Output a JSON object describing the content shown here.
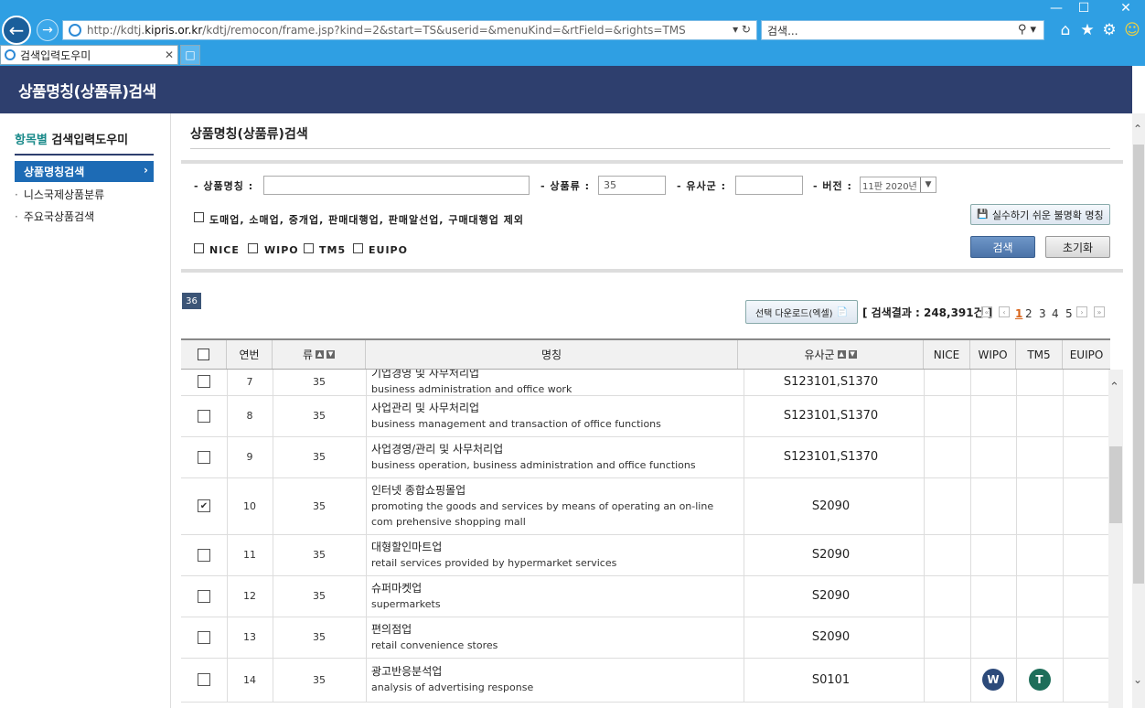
{
  "browser": {
    "url_prefix": "http://kdtj.",
    "url_domain": "kipris.or.kr",
    "url_rest": "/kdtj/remocon/frame.jsp?kind=2&start=TS&userid=&menuKind=&rtField=&rights=TMS",
    "search_placeholder": "검색...",
    "tab_title": "검색입력도우미"
  },
  "page": {
    "header_title": "상품명칭(상품류)검색",
    "main_title": "상품명칭(상품류)검색"
  },
  "sidebar": {
    "title_highlight": "항목별",
    "title_rest": " 검색입력도우미",
    "active_item": "상품명칭검색",
    "items": [
      "니스국제상품분류",
      "주요국상품검색"
    ]
  },
  "form": {
    "name_label": "- 상품명칭 :",
    "name_value": "",
    "class_label": "- 상품류 :",
    "class_value": "35",
    "similar_label": "- 유사군 :",
    "similar_value": "",
    "version_label": "- 버전 :",
    "version_value": "11판 2020년",
    "exclude_label": "도매업, 소매업, 중개업, 판매대행업, 판매알선업, 구매대행업 제외",
    "filters": [
      "NICE",
      "WIPO",
      "TM5",
      "EUIPO"
    ],
    "mistake_button": "실수하기 쉬운 불명확 명칭",
    "search_button": "검색",
    "reset_button": "초기화"
  },
  "results": {
    "count_badge": "36",
    "download_button": "선택 다운로드(엑셀)",
    "result_label": "[ 검색결과 : 248,391건 ]",
    "pages": [
      "1",
      "2",
      "3",
      "4",
      "5"
    ],
    "current_page": "1"
  },
  "table": {
    "headers": {
      "no": "연번",
      "class": "류",
      "name": "명칭",
      "similar": "유사군",
      "nice": "NICE",
      "wipo": "WIPO",
      "tm5": "TM5",
      "euipo": "EUIPO"
    },
    "rows": [
      {
        "no": "7",
        "class": "35",
        "ko": "기업경영 및 사무처리업",
        "en": "business administration and office work",
        "similar": "S123101,S1370",
        "checked": false,
        "wipo": "",
        "tm5": ""
      },
      {
        "no": "8",
        "class": "35",
        "ko": "사업관리 및 사무처리업",
        "en": "business management and transaction of office functions",
        "similar": "S123101,S1370",
        "checked": false,
        "wipo": "",
        "tm5": ""
      },
      {
        "no": "9",
        "class": "35",
        "ko": "사업경영/관리 및 사무처리업",
        "en": "business operation, business administration and office functions",
        "similar": "S123101,S1370",
        "checked": false,
        "wipo": "",
        "tm5": ""
      },
      {
        "no": "10",
        "class": "35",
        "ko": "인터넷 종합쇼핑몰업",
        "en": "promoting the goods and services by means of operating an on-line com prehensive shopping mall",
        "similar": "S2090",
        "checked": true,
        "wipo": "",
        "tm5": ""
      },
      {
        "no": "11",
        "class": "35",
        "ko": "대형할인마트업",
        "en": "retail services provided by hypermarket services",
        "similar": "S2090",
        "checked": false,
        "wipo": "",
        "tm5": ""
      },
      {
        "no": "12",
        "class": "35",
        "ko": "슈퍼마켓업",
        "en": "supermarkets",
        "similar": "S2090",
        "checked": false,
        "wipo": "",
        "tm5": ""
      },
      {
        "no": "13",
        "class": "35",
        "ko": "편의점업",
        "en": "retail convenience stores",
        "similar": "S2090",
        "checked": false,
        "wipo": "",
        "tm5": ""
      },
      {
        "no": "14",
        "class": "35",
        "ko": "광고반응분석업",
        "en": "analysis of advertising response",
        "similar": "S0101",
        "checked": false,
        "wipo": "W",
        "tm5": "T"
      }
    ]
  },
  "colors": {
    "header_bg": "#2e3f6e",
    "active_blue": "#1d6bb5",
    "wipo_badge": "#2c4a7a",
    "tm5_badge": "#1e6e5a",
    "current_page": "#d8641a"
  }
}
